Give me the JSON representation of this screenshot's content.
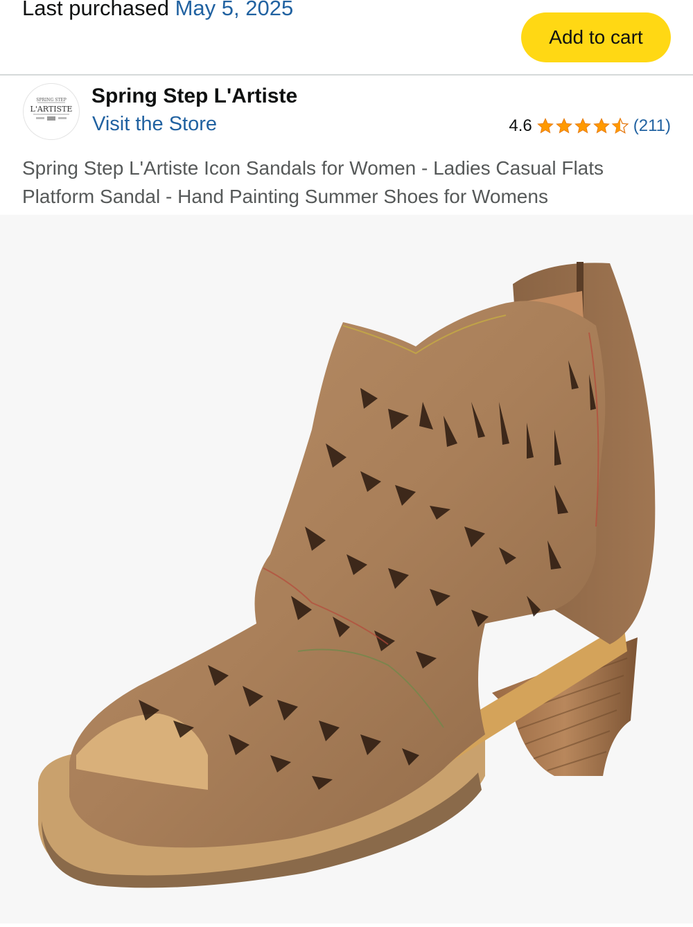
{
  "header": {
    "last_purchased_label": "Last purchased",
    "last_purchased_date": "May 5, 2025",
    "add_to_cart_label": "Add to cart"
  },
  "brand": {
    "name": "Spring Step L'Artiste",
    "visit_store_label": "Visit the Store",
    "logo_text_top": "SPRING STEP",
    "logo_text_main": "L'ARTISTE",
    "rating_value": "4.6",
    "rating_stars": 4.6,
    "rating_count": "(211)"
  },
  "product": {
    "title": "Spring Step L'Artiste Icon Sandals for Women - Ladies Casual Flats Platform Sandal - Hand Painting Summer Shoes for Womens",
    "image_alt": "tan leather cutout peep-toe heeled bootie sandal"
  },
  "colors": {
    "link": "#2162a1",
    "star": "#ff9900",
    "button": "#ffd814"
  }
}
